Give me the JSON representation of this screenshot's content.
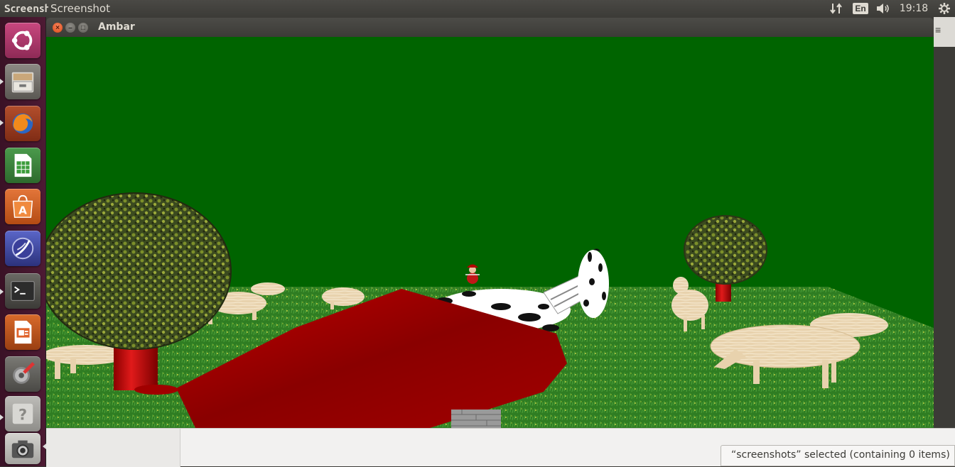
{
  "top_panel": {
    "app_name": "Screenshot",
    "window_title": "Screenshot",
    "language": "En",
    "clock": "19:18"
  },
  "window": {
    "title": "Ambar",
    "close_glyph": "×",
    "min_glyph": "–",
    "max_glyph": "□"
  },
  "launcher": {
    "items": [
      "ubuntu-dash-icon",
      "files-icon",
      "firefox-icon",
      "libreoffice-calc-icon",
      "software-center-icon",
      "eclipse-icon",
      "terminal-icon",
      "libreoffice-impress-icon",
      "system-settings-icon",
      "unknown-app-icon",
      "screenshot-icon"
    ]
  },
  "file_manager": {
    "status": "“screenshots” selected  (containing 0 items)",
    "menu_glyph": "≡"
  },
  "scene": {
    "sky_color": "#006400",
    "grass_color": "#2d7a1f",
    "barn_roof_color": "#a00000",
    "objects": [
      "tree-left",
      "tree-right",
      "barn-roof",
      "cow",
      "sheep-group",
      "small-figure"
    ]
  }
}
